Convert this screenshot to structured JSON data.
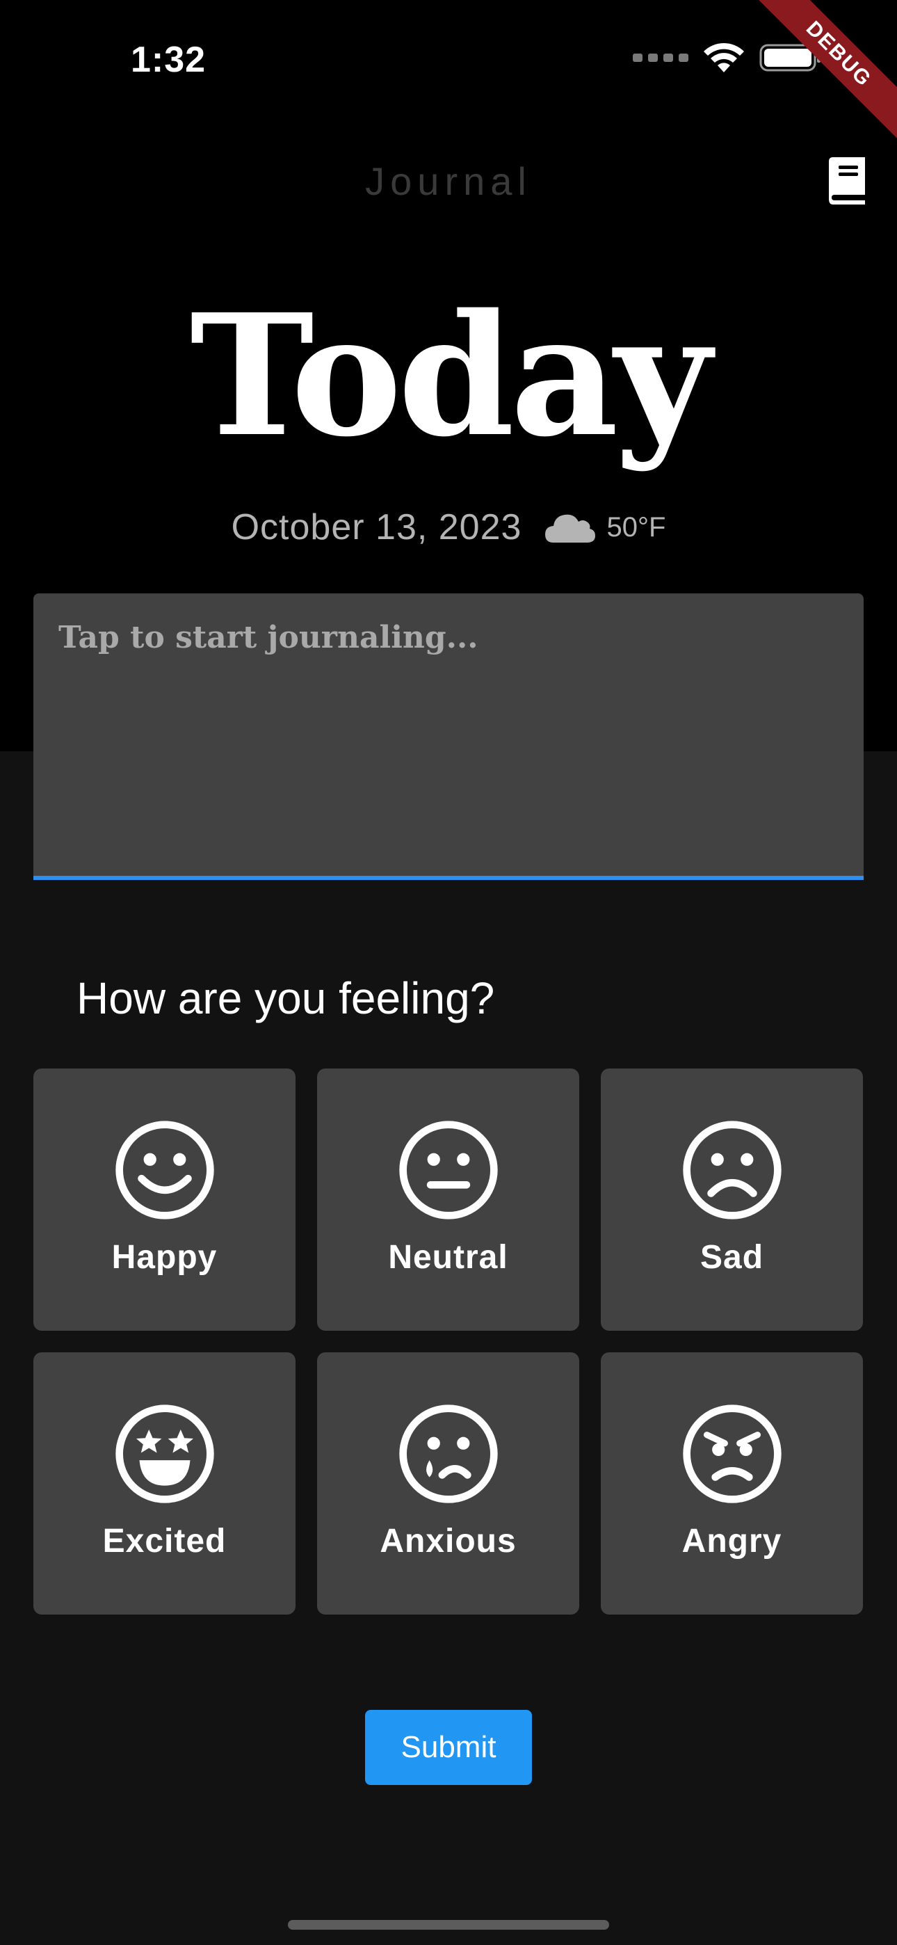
{
  "status_bar": {
    "time": "1:32"
  },
  "debug_banner": {
    "label": "DEBUG"
  },
  "nav": {
    "title": "Journal",
    "action_icon": "book-icon"
  },
  "header": {
    "title": "Today",
    "date": "October 13, 2023",
    "weather_icon": "cloud-icon",
    "temperature": "50°F"
  },
  "journal": {
    "placeholder": "Tap to start journaling...",
    "value": ""
  },
  "mood": {
    "question": "How are you feeling?",
    "options": [
      {
        "label": "Happy",
        "icon": "happy-face-icon"
      },
      {
        "label": "Neutral",
        "icon": "neutral-face-icon"
      },
      {
        "label": "Sad",
        "icon": "sad-face-icon"
      },
      {
        "label": "Excited",
        "icon": "star-eyes-face-icon"
      },
      {
        "label": "Anxious",
        "icon": "anxious-face-icon"
      },
      {
        "label": "Angry",
        "icon": "angry-face-icon"
      }
    ]
  },
  "submit": {
    "label": "Submit"
  },
  "colors": {
    "accent": "#2196f3",
    "card": "#424242",
    "top_background": "#000000",
    "bottom_background": "#121212",
    "debug_ribbon": "#8b1a1f"
  }
}
